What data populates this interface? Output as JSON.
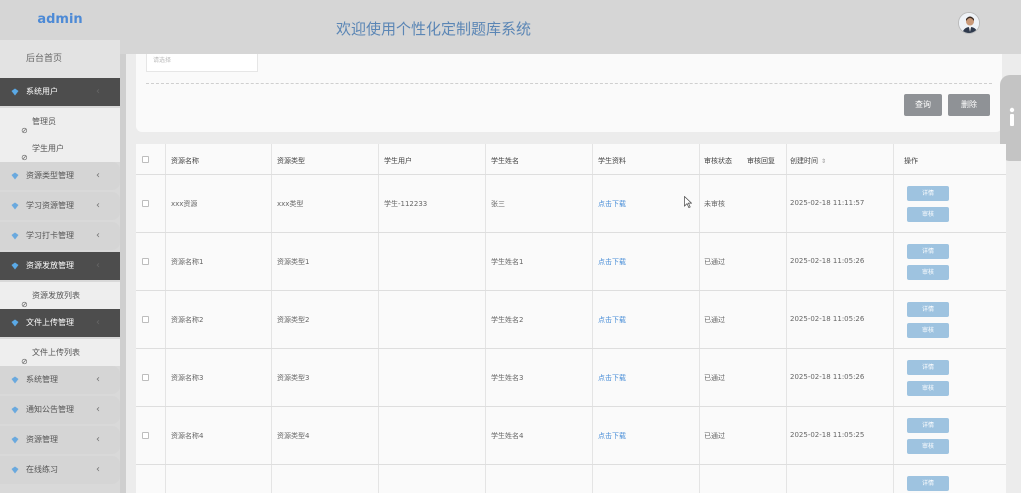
{
  "brand": "admin",
  "header": {
    "title": "欢迎使用个性化定制题库系统"
  },
  "sidebar": {
    "home": "后台首页",
    "items": [
      {
        "label": "系统用户",
        "active": true,
        "expanded": true,
        "subs": [
          "管理员",
          "学生用户"
        ]
      },
      {
        "label": "资源类型管理",
        "active": false
      },
      {
        "label": "学习资源管理",
        "active": false
      },
      {
        "label": "学习打卡管理",
        "active": false
      },
      {
        "label": "资源发放管理",
        "active": true,
        "expanded": true,
        "subs": [
          "资源发放列表"
        ]
      },
      {
        "label": "文件上传管理",
        "active": true,
        "expanded": true,
        "subs": [
          "文件上传列表"
        ]
      },
      {
        "label": "系统管理",
        "active": false
      },
      {
        "label": "通知公告管理",
        "active": false
      },
      {
        "label": "资源管理",
        "active": false
      },
      {
        "label": "在线练习",
        "active": false
      }
    ],
    "arrow": "‹"
  },
  "search": {
    "placeholder": "请选择",
    "query_label": "查询",
    "delete_label": "删除"
  },
  "table": {
    "headers": [
      "资源名称",
      "资源类型",
      "学生用户",
      "学生姓名",
      "学生资料",
      "审核状态",
      "审核回复",
      "创建时间",
      "操作"
    ],
    "sort_icon": "⇕",
    "rows": [
      {
        "name": "xxx资源",
        "type": "xxx类型",
        "user": "学生-112233",
        "student": "张三",
        "file": "点击下载",
        "status": "未审核",
        "created": "2025-02-18 11:11:57"
      },
      {
        "name": "资源名称1",
        "type": "资源类型1",
        "user": "",
        "student": "学生姓名1",
        "file": "点击下载",
        "status": "已通过",
        "created": "2025-02-18 11:05:26"
      },
      {
        "name": "资源名称2",
        "type": "资源类型2",
        "user": "",
        "student": "学生姓名2",
        "file": "点击下载",
        "status": "已通过",
        "created": "2025-02-18 11:05:26"
      },
      {
        "name": "资源名称3",
        "type": "资源类型3",
        "user": "",
        "student": "学生姓名3",
        "file": "点击下载",
        "status": "已通过",
        "created": "2025-02-18 11:05:26"
      },
      {
        "name": "资源名称4",
        "type": "资源类型4",
        "user": "",
        "student": "学生姓名4",
        "file": "点击下载",
        "status": "已通过",
        "created": "2025-02-18 11:05:25"
      }
    ],
    "action_detail": "详情",
    "action_review": "审核"
  },
  "colors": {
    "accent": "#4a8fd8",
    "active_menu": "#4d4d4d",
    "action_button": "#9ec3e0"
  }
}
